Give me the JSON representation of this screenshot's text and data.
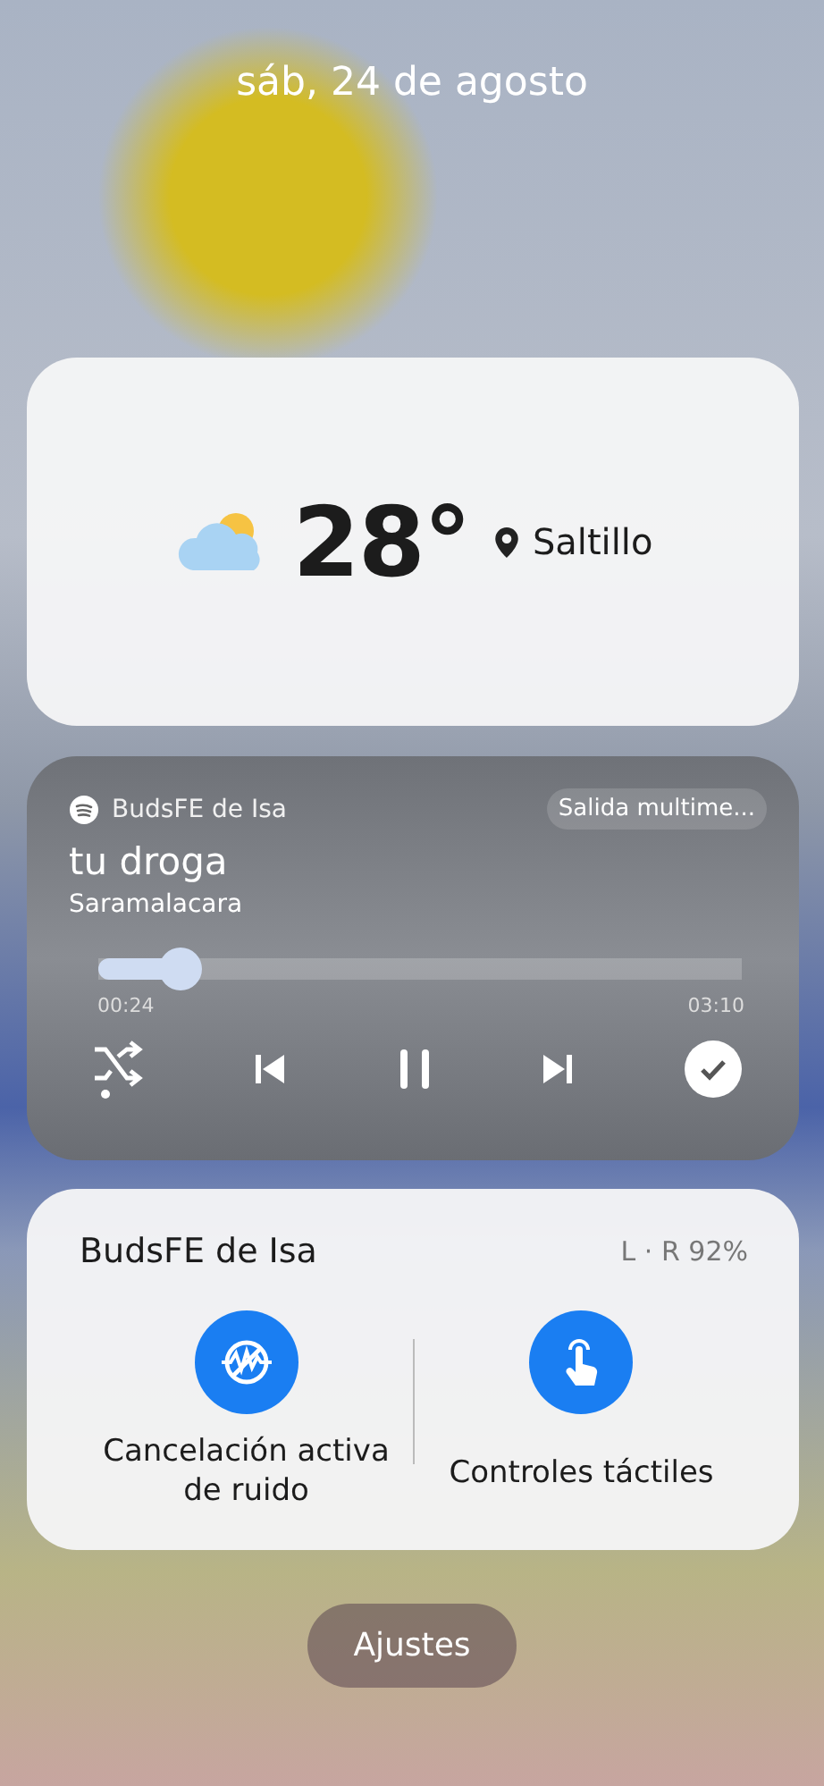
{
  "date": "sáb, 24 de agosto",
  "weather": {
    "temperature": "28°",
    "location": "Saltillo"
  },
  "media": {
    "source": "BudsFE de Isa",
    "output_button": "Salida multime...",
    "title": "tu droga",
    "artist": "Saramalacara",
    "level": 0.13,
    "elapsed": "00:24",
    "duration": "03:10",
    "shuffle_on": true,
    "playing": true
  },
  "buds": {
    "name": "BudsFE de Isa",
    "battery": "L · R 92%",
    "features": [
      {
        "kind": "noise",
        "label": "Cancelación activa de ruido",
        "on": true
      },
      {
        "kind": "touch",
        "label": "Controles táctiles",
        "on": true
      }
    ]
  },
  "settings_button": "Ajustes"
}
